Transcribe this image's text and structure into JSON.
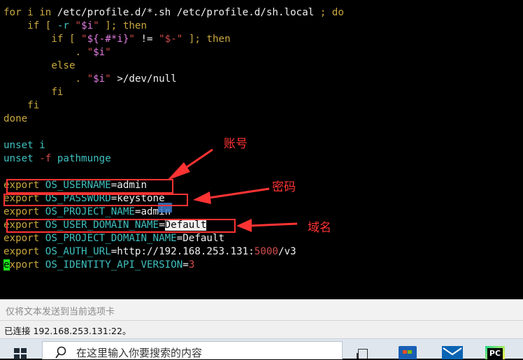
{
  "terminal": {
    "lines": {
      "l0": {
        "a": "for i in ",
        "b": "/etc/profile.d/*.sh /etc/profile.d/sh.local ",
        "c": "; do"
      },
      "l1": {
        "a": "    if [ ",
        "b": "-r ",
        "c": "\"",
        "d": "$i",
        "e": "\"",
        "f": " ]; then"
      },
      "l2": {
        "a": "        if [ ",
        "b": "\"",
        "c": "${-#*i}",
        "d": "\"",
        "e": " != ",
        "f": "\"$-\"",
        "g": " ]; then"
      },
      "l3": {
        "a": "            . ",
        "b": "\"",
        "c": "$i",
        "d": "\""
      },
      "l4": {
        "a": "        else"
      },
      "l5": {
        "a": "            . ",
        "b": "\"",
        "c": "$i",
        "d": "\"",
        "e": " >/dev/null"
      },
      "l6": {
        "a": "        fi"
      },
      "l7": {
        "a": "    fi"
      },
      "l8": {
        "a": "done"
      },
      "l10": {
        "a": "unset ",
        "b": "i"
      },
      "l11": {
        "a": "unset ",
        "b": "-f ",
        "c": "pathmunge"
      },
      "l13": {
        "a": "export ",
        "b": "OS_USERNAME",
        "c": "=admin"
      },
      "l14": {
        "a": "export ",
        "b": "OS_PASSWORD",
        "c": "=keystone"
      },
      "l15": {
        "a": "export ",
        "b": "OS_PROJECT_NAME",
        "c": "=admin"
      },
      "l16": {
        "a": "export ",
        "b": "OS_USER_DOMAIN_NAME",
        "c": "=",
        "d": "Default"
      },
      "l17": {
        "a": "export ",
        "b": "OS_PROJECT_DOMAIN_NAME",
        "c": "=Default"
      },
      "l18": {
        "a": "export ",
        "b": "OS_AUTH_URL",
        "c": "=http://192.168.253.131:",
        "d": "5000",
        "e": "/v3"
      },
      "l19": {
        "a": "e",
        "b": "xport ",
        "c": "OS_IDENTITY_API_VERSION",
        "d": "=",
        "e": "3"
      }
    }
  },
  "annotations": {
    "account": "账号",
    "password": "密码",
    "domain": "域名"
  },
  "send_bar": {
    "placeholder": "仅将文本发送到当前选项卡"
  },
  "status_bar": {
    "text": "已连接 192.168.253.131:22。"
  },
  "taskbar": {
    "search_text": "在这里输入你要搜索的内容"
  },
  "colors": {
    "keyword": "#c9a73e",
    "variable": "#e07be0",
    "string": "#d24b4b",
    "cyan": "#3fc0c0",
    "annotation": "#ff3333",
    "cursor": "#19e619"
  }
}
